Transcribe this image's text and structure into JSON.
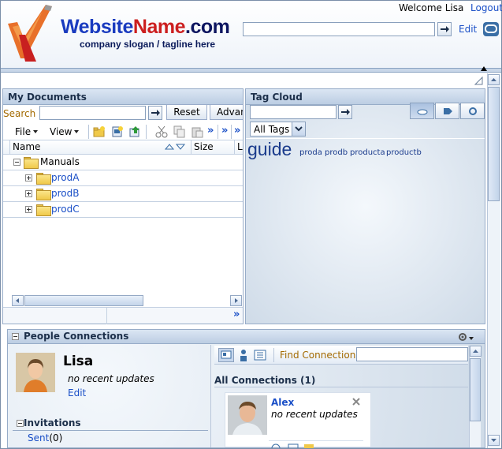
{
  "header": {
    "site_name_part1": "Website",
    "site_name_part2": "Name",
    "site_name_part3": ".com",
    "slogan": "company slogan / tagline here",
    "welcome": "Welcome Lisa",
    "logout": "Logout",
    "edit": "Edit"
  },
  "documents": {
    "title": "My Documents",
    "search_label": "Search",
    "reset_label": "Reset",
    "advanced_label": "Advan",
    "menu_file": "File",
    "menu_view": "View",
    "col_name": "Name",
    "col_size": "Size",
    "col_l": "L",
    "tree": [
      {
        "label": "Manuals",
        "expanded": true
      },
      {
        "label": "prodA",
        "expanded": false
      },
      {
        "label": "prodB",
        "expanded": false
      },
      {
        "label": "prodC",
        "expanded": false
      }
    ]
  },
  "tags": {
    "title": "Tag Cloud",
    "filter": "All Tags",
    "cloud": [
      {
        "label": "guide",
        "size": "large"
      },
      {
        "label": "proda",
        "size": "small"
      },
      {
        "label": "prodb",
        "size": "small"
      },
      {
        "label": "producta",
        "size": "small"
      },
      {
        "label": "productb",
        "size": "small"
      }
    ]
  },
  "people": {
    "title": "People Connections",
    "profile_name": "Lisa",
    "profile_status": "no recent updates",
    "profile_edit": "Edit",
    "invitations_label": "Invitations",
    "sent_label": "Sent",
    "sent_count": "(0)",
    "find_label": "Find Connection",
    "all_connections": "All Connections (1)",
    "connection": {
      "name": "Alex",
      "status": "no recent updates"
    }
  },
  "colors": {
    "link": "#1a4fc7",
    "label_orange": "#a36a00",
    "panel_header": "#bccde3"
  }
}
